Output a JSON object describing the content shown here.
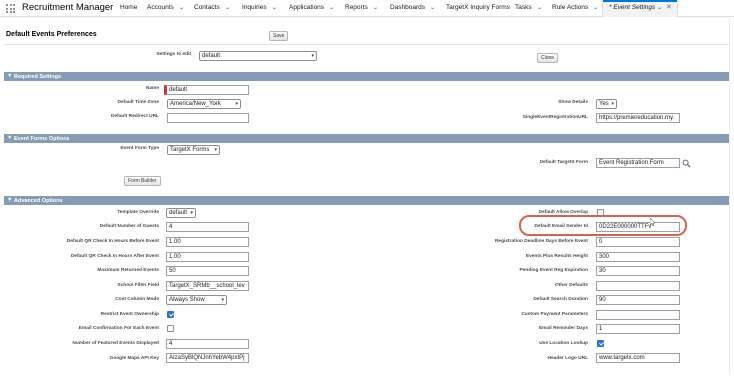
{
  "nav": {
    "app_name": "Recruitment Manager",
    "tabs": [
      {
        "label": "Home",
        "has_menu": false
      },
      {
        "label": "Accounts",
        "has_menu": true
      },
      {
        "label": "Contacts",
        "has_menu": true
      },
      {
        "label": "Inquiries",
        "has_menu": true
      },
      {
        "label": "Applications",
        "has_menu": true
      },
      {
        "label": "Reports",
        "has_menu": true
      },
      {
        "label": "Dashboards",
        "has_menu": true
      },
      {
        "label": "TargetX Inquiry Forms",
        "has_menu": false
      },
      {
        "label": "Tasks",
        "has_menu": true
      },
      {
        "label": "Rule Actions",
        "has_menu": true
      }
    ],
    "active_tab": {
      "label": "* Event Settings",
      "has_menu": true
    }
  },
  "header": {
    "title": "Default Events Preferences",
    "save_label": "Save",
    "settings_label": "Settings to edit",
    "settings_value": "default",
    "clone_label": "Clone"
  },
  "sections": {
    "required": "Required Settings",
    "forms": "Event Forms Options",
    "advanced": "Advanced Options"
  },
  "required": {
    "name_label": "Name",
    "name_value": "default",
    "timezone_label": "Default Time Zone",
    "timezone_value": "America/New_York",
    "redirect_label": "Default Redirect URL",
    "redirect_value": "",
    "show_details_label": "Show Details",
    "show_details_value": "Yes",
    "single_event_label": "SingleEventRegistrationURL",
    "single_event_value": "https://premiereducation.my."
  },
  "forms": {
    "form_type_label": "Event Form Type",
    "form_type_value": "TargetX Forms",
    "form_builder_label": "Form Builder",
    "default_form_label": "Default TargetX Form",
    "default_form_value": "Event Registration Form"
  },
  "advanced": {
    "template_override_label": "Template Override",
    "template_override_value": "default",
    "num_guests_label": "Default Number of Guests",
    "num_guests_value": "4",
    "qr_before_label": "Default QR Check In Hours Before Event",
    "qr_before_value": "1.00",
    "qr_after_label": "Default QR Check In Hours After Event",
    "qr_after_value": "1.00",
    "max_returned_label": "Maximum Returned Events",
    "max_returned_value": "50",
    "school_filter_label": "School Filter Field",
    "school_filter_value": "TargetX_SRMb__school_lev",
    "cost_column_label": "Cost Column Mode",
    "cost_column_value": "Always Show",
    "restrict_ownership_label": "Restrict Event Ownership",
    "restrict_ownership_checked": true,
    "email_confirmation_label": "Email Confirmation For Each Event",
    "email_confirmation_checked": false,
    "featured_label": "Number of Featured Events Displayed",
    "featured_value": "4",
    "maps_key_label": "Google Maps API Key",
    "maps_key_value": "AIzaSyBlQNJnhYebW4pxtPj",
    "allow_overlap_label": "Default Allow Overlap",
    "allow_overlap_checked": false,
    "sender_id_label": "Default Email Sender Id",
    "sender_id_value": "0D22E000000TTFv",
    "deadline_days_label": "Registration Deadline Days Before Event",
    "deadline_days_value": "0",
    "results_height_label": "Events Plus Results Height",
    "results_height_value": "300",
    "pending_exp_label": "Pending Event Reg Expiration",
    "pending_exp_value": "30",
    "other_defaults_label": "Other Defaults",
    "other_defaults_value": "",
    "search_duration_label": "Default Search Duration",
    "search_duration_value": "90",
    "custom_payment_label": "Custom Payment Parameters",
    "custom_payment_value": "",
    "reminder_days_label": "Email Reminder Days",
    "reminder_days_value": "1",
    "location_lookup_label": "Use Location Lookup",
    "location_lookup_checked": true,
    "header_logo_label": "Header Logo URL",
    "header_logo_value": "www.targetx.com"
  },
  "colors": {
    "section_bar": "#869cb5",
    "highlight_ring": "#d9624f",
    "checkbox_on": "#2f6fd6",
    "active_tab_indicator": "#0176d3"
  }
}
